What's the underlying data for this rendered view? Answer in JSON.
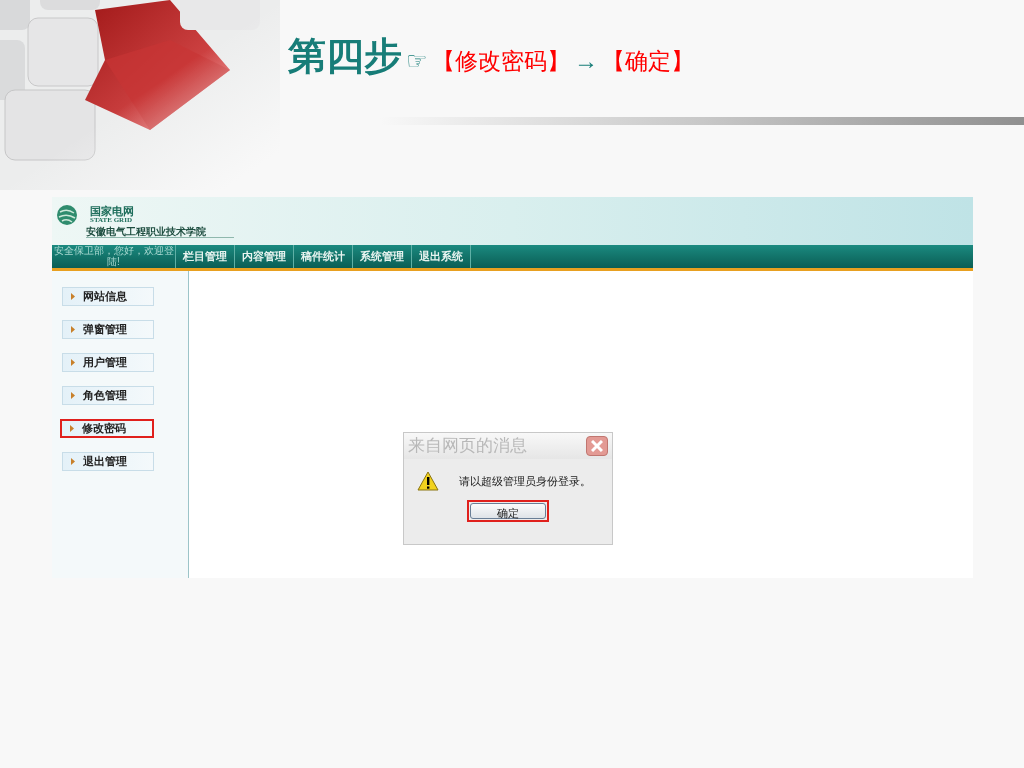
{
  "slide": {
    "title_parts": [
      {
        "kind": "step",
        "text": "第四步"
      },
      {
        "kind": "symbol",
        "text": "☞"
      },
      {
        "kind": "target",
        "text": "【修改密码】"
      },
      {
        "kind": "symbol",
        "text": "→"
      },
      {
        "kind": "target",
        "text": "【确定】"
      }
    ]
  },
  "screen": {
    "header": {
      "logo_name": "国家电网",
      "logo_subtitle": "STATE GRID",
      "school": "安徽电气工程职业技术学院"
    },
    "nav": {
      "greeting": "安全保卫部，您好，欢迎登陆!",
      "items": [
        "栏目管理",
        "内容管理",
        "稿件统计",
        "系统管理",
        "退出系统"
      ]
    },
    "sidebar": {
      "items": [
        {
          "label": "网站信息",
          "highlighted": false
        },
        {
          "label": "弹窗管理",
          "highlighted": false
        },
        {
          "label": "用户管理",
          "highlighted": false
        },
        {
          "label": "角色管理",
          "highlighted": false
        },
        {
          "label": "修改密码",
          "highlighted": true
        },
        {
          "label": "退出管理",
          "highlighted": false
        }
      ]
    },
    "dialog": {
      "title": "来自网页的消息",
      "message": "请以超级管理员身份登录。",
      "button": {
        "label": "确定",
        "highlighted": true
      }
    }
  }
}
